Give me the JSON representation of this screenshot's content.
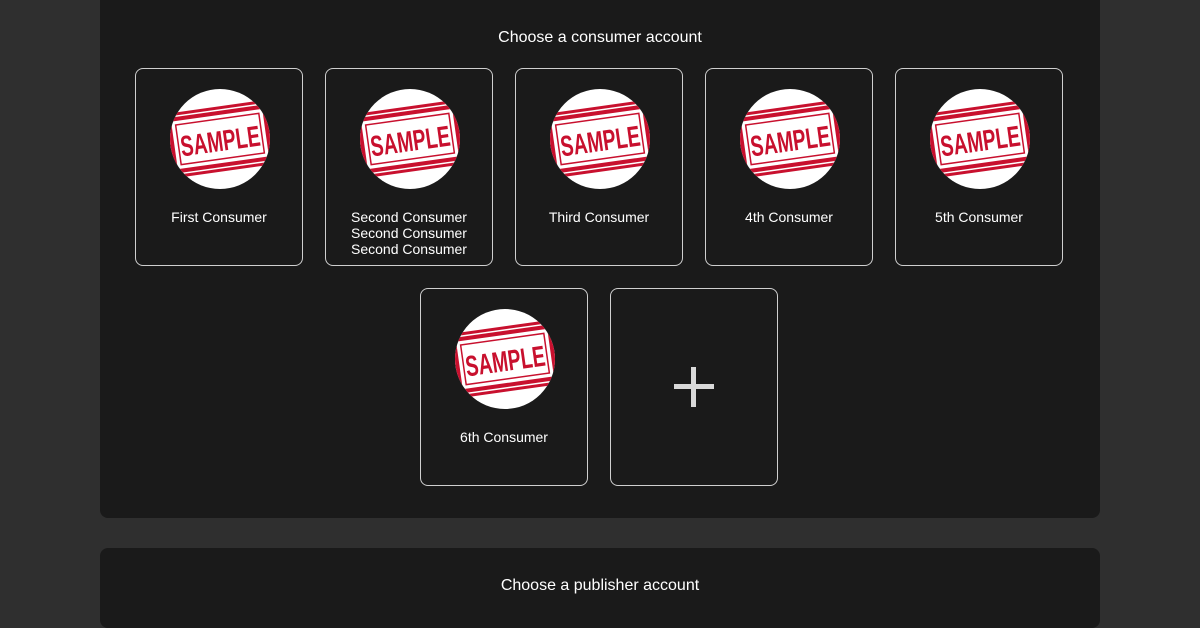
{
  "consumer_section": {
    "title": "Choose a consumer account",
    "accounts": [
      {
        "label": "First Consumer",
        "avatar": "sample-stamp-icon"
      },
      {
        "label": "Second Consumer Second Consumer Second Consumer",
        "avatar": "sample-stamp-icon"
      },
      {
        "label": "Third Consumer",
        "avatar": "sample-stamp-icon"
      },
      {
        "label": "4th Consumer",
        "avatar": "sample-stamp-icon"
      },
      {
        "label": "5th Consumer",
        "avatar": "sample-stamp-icon"
      },
      {
        "label": "6th Consumer",
        "avatar": "sample-stamp-icon"
      }
    ],
    "add_button_icon": "plus-icon",
    "stamp_text": "SAMPLE"
  },
  "publisher_section": {
    "title": "Choose a publisher account"
  },
  "colors": {
    "page_background": "#2f2f2f",
    "panel_background": "#1a1a1a",
    "card_border": "#cfcfcf",
    "stamp_red": "#c8102e",
    "plus_color": "#d9d9d9"
  }
}
